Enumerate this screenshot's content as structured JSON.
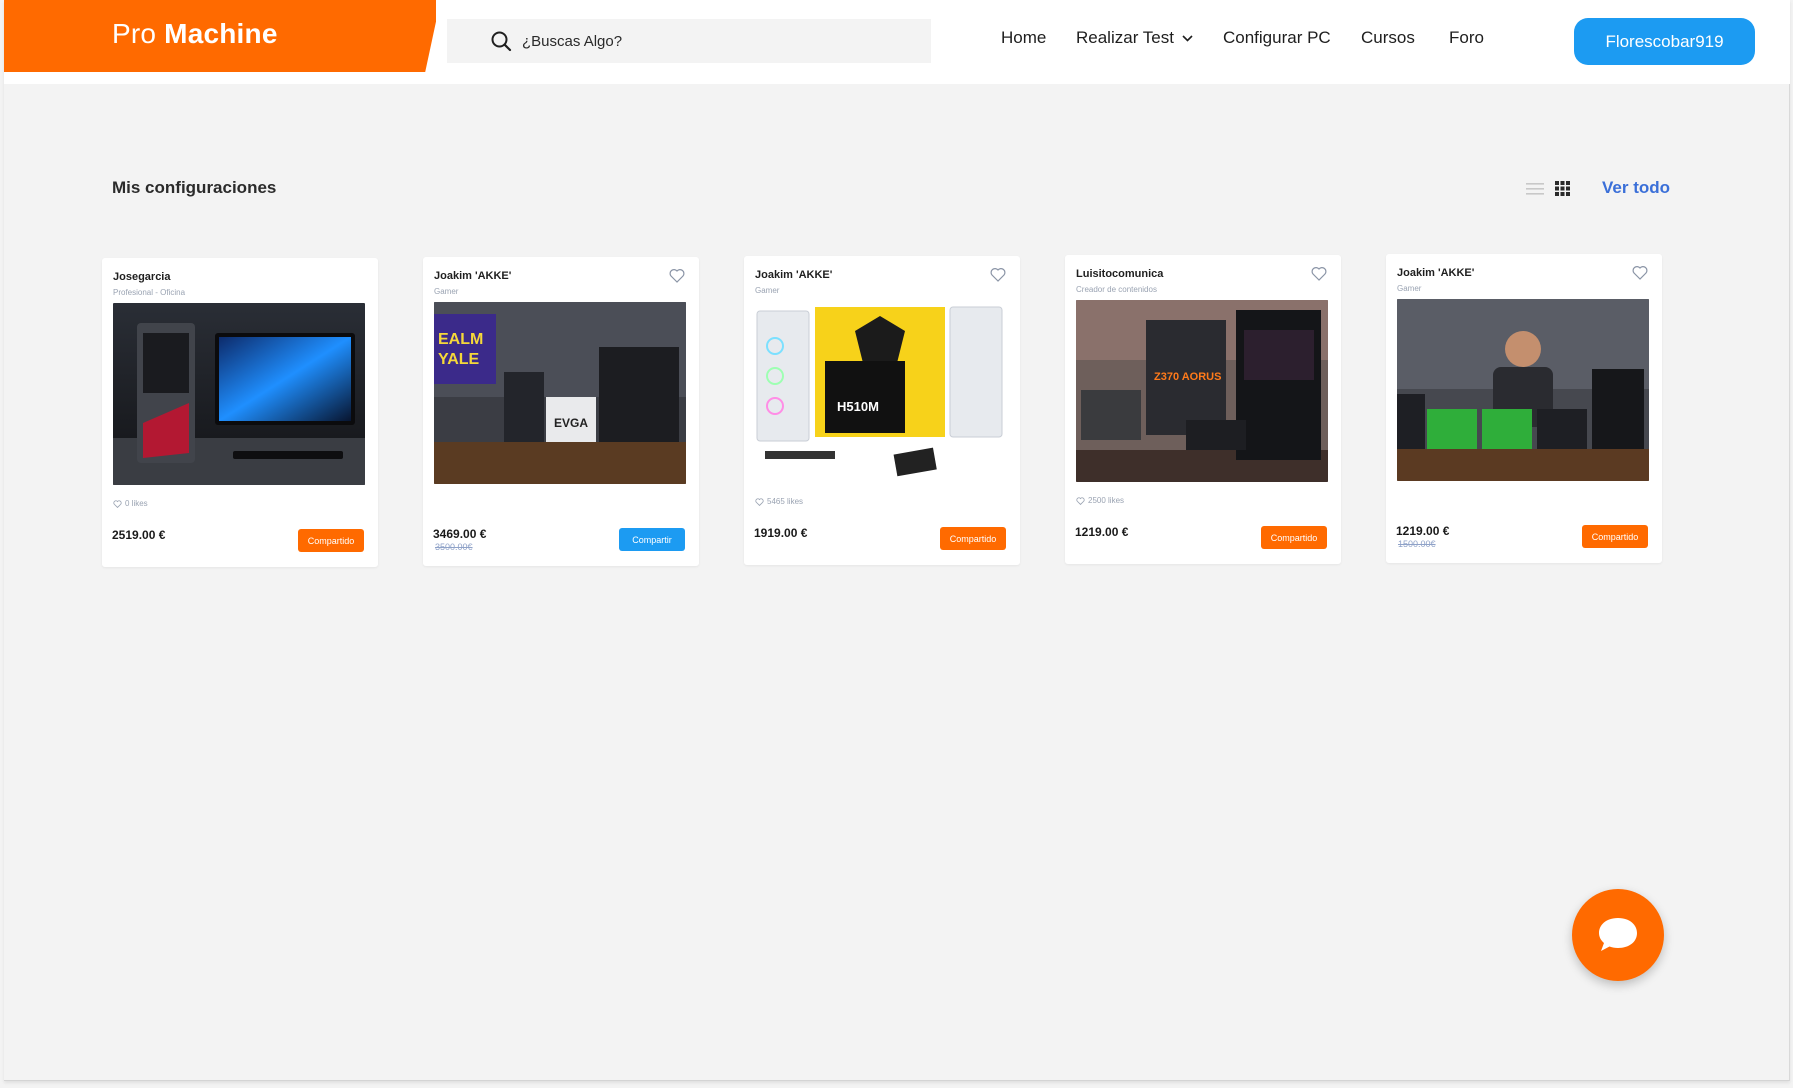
{
  "brand": {
    "name_light": "Pro",
    "name_bold": "Machine",
    "color": "#ff6a00"
  },
  "search": {
    "placeholder": "¿Buscas Algo?",
    "icon": "search-icon"
  },
  "nav": {
    "items": [
      {
        "label": "Home"
      },
      {
        "label": "Realizar Test",
        "icon": "chevron-down-icon"
      },
      {
        "label": "Configurar PC"
      },
      {
        "label": "Cursos"
      },
      {
        "label": "Foro"
      }
    ]
  },
  "user": {
    "name": "Florescobar919",
    "color": "#1c9bf2"
  },
  "section": {
    "title": "Mis configuraciones",
    "see_all": "Ver todo",
    "view_icons": [
      "list-view-icon",
      "grid-view-icon"
    ]
  },
  "cards": [
    {
      "author": "Josegarcia",
      "subtitle": "Profesional - Oficina",
      "likes": "0 likes",
      "price": "2519.00 €",
      "old_price": "",
      "button": "Compartido",
      "button_color": "#ff6a00",
      "has_heart": false
    },
    {
      "author": "Joakim 'AKKE'",
      "subtitle": "Gamer",
      "likes": "",
      "price": "3469.00 €",
      "old_price": "3500.00€",
      "button": "Compartir",
      "button_color": "#1c9bf2",
      "has_heart": true
    },
    {
      "author": "Joakim 'AKKE'",
      "subtitle": "Gamer",
      "likes": "5465 likes",
      "price": "1919.00 €",
      "old_price": "",
      "button": "Compartido",
      "button_color": "#ff6a00",
      "has_heart": true
    },
    {
      "author": "Luisitocomunica",
      "subtitle": "Creador de contenidos",
      "likes": "2500 likes",
      "price": "1219.00 €",
      "old_price": "",
      "button": "Compartido",
      "button_color": "#ff6a00",
      "has_heart": true
    },
    {
      "author": "Joakim 'AKKE'",
      "subtitle": "Gamer",
      "likes": "",
      "price": "1219.00 €",
      "old_price": "1500.00€",
      "button": "Compartido",
      "button_color": "#ff6a00",
      "has_heart": true
    }
  ],
  "chat": {
    "icon": "chat-bubble-icon"
  }
}
